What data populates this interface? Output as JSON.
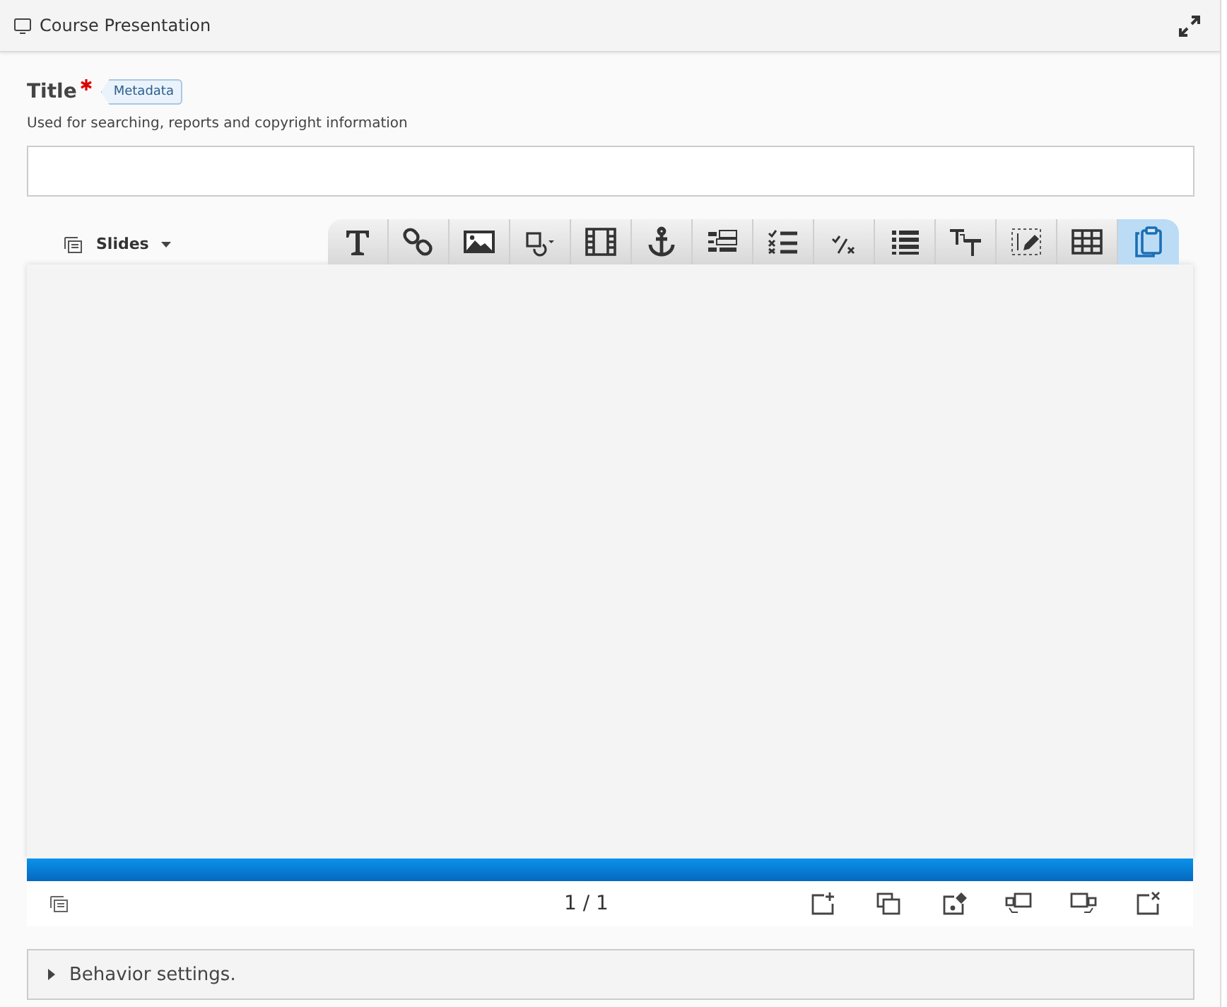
{
  "header": {
    "title": "Course Presentation"
  },
  "title_field": {
    "label": "Title",
    "required": true,
    "badge": "Metadata",
    "description": "Used for searching, reports and copyright information"
  },
  "slides_menu": {
    "label": "Slides"
  },
  "toolbar": [
    {
      "kind": "text",
      "selected": false
    },
    {
      "kind": "link",
      "selected": false
    },
    {
      "kind": "image",
      "selected": false
    },
    {
      "kind": "shapes",
      "selected": false
    },
    {
      "kind": "video",
      "selected": false
    },
    {
      "kind": "anchor",
      "selected": false
    },
    {
      "kind": "fields",
      "selected": false
    },
    {
      "kind": "checklist",
      "selected": false
    },
    {
      "kind": "truefalse",
      "selected": false
    },
    {
      "kind": "list",
      "selected": false
    },
    {
      "kind": "fonts",
      "selected": false
    },
    {
      "kind": "editbox",
      "selected": false
    },
    {
      "kind": "table",
      "selected": false
    },
    {
      "kind": "paste",
      "selected": true
    }
  ],
  "progress": {
    "level": 1
  },
  "pager": "1 / 1",
  "slide_actions": [
    {
      "kind": "add"
    },
    {
      "kind": "clone"
    },
    {
      "kind": "background"
    },
    {
      "kind": "move-left"
    },
    {
      "kind": "move-right"
    },
    {
      "kind": "delete"
    }
  ],
  "behavior": {
    "label": "Behavior settings.",
    "expanded": false
  }
}
